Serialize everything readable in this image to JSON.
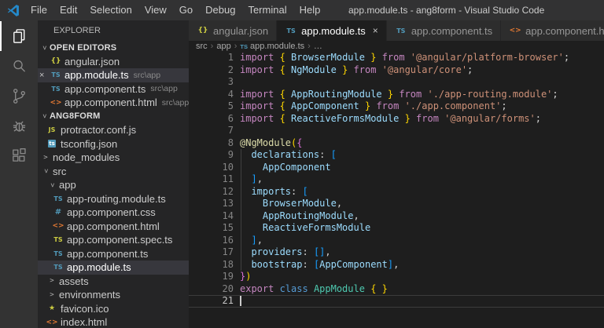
{
  "titlebar": {
    "logo_icon": "vscode-logo-icon",
    "menus": [
      "File",
      "Edit",
      "Selection",
      "View",
      "Go",
      "Debug",
      "Terminal",
      "Help"
    ],
    "title": "app.module.ts - ang8form - Visual Studio Code"
  },
  "activity_bar": [
    {
      "icon": "explorer-icon",
      "active": true
    },
    {
      "icon": "search-icon",
      "active": false
    },
    {
      "icon": "source-control-icon",
      "active": false
    },
    {
      "icon": "debug-icon",
      "active": false
    },
    {
      "icon": "extensions-icon",
      "active": false
    }
  ],
  "sidebar": {
    "title": "EXPLORER",
    "rows": [
      {
        "type": "section",
        "label": "OPEN EDITORS",
        "chevron": "down"
      },
      {
        "type": "editor",
        "label": "angular.json",
        "icon": "json-icon"
      },
      {
        "type": "editor",
        "label": "app.module.ts",
        "desc": "src\\app",
        "icon": "ts-icon",
        "close": true,
        "selected": true
      },
      {
        "type": "editor",
        "label": "app.component.ts",
        "desc": "src\\app",
        "icon": "ts-icon"
      },
      {
        "type": "editor",
        "label": "app.component.html",
        "desc": "src\\app",
        "icon": "html-icon"
      },
      {
        "type": "section",
        "label": "ANG8FORM",
        "chevron": "down"
      },
      {
        "type": "file",
        "label": "protractor.conf.js",
        "icon": "js-icon",
        "indent": 8
      },
      {
        "type": "file",
        "label": "tsconfig.json",
        "icon": "tsconfig-icon",
        "indent": 8
      },
      {
        "type": "folder",
        "label": "node_modules",
        "chevron": "right",
        "indent": 2
      },
      {
        "type": "folder",
        "label": "src",
        "chevron": "down",
        "indent": 2
      },
      {
        "type": "folder",
        "label": "app",
        "chevron": "down",
        "indent": 10
      },
      {
        "type": "file",
        "label": "app-routing.module.ts",
        "icon": "ts-icon",
        "indent": 16
      },
      {
        "type": "file",
        "label": "app.component.css",
        "icon": "css-icon",
        "indent": 16
      },
      {
        "type": "file",
        "label": "app.component.html",
        "icon": "html-icon",
        "indent": 16
      },
      {
        "type": "file",
        "label": "app.component.spec.ts",
        "icon": "ts-spec-icon",
        "indent": 16
      },
      {
        "type": "file",
        "label": "app.component.ts",
        "icon": "ts-icon",
        "indent": 16
      },
      {
        "type": "file",
        "label": "app.module.ts",
        "icon": "ts-icon",
        "indent": 16,
        "selected": true
      },
      {
        "type": "folder",
        "label": "assets",
        "chevron": "right",
        "indent": 10
      },
      {
        "type": "folder",
        "label": "environments",
        "chevron": "right",
        "indent": 10
      },
      {
        "type": "file",
        "label": "favicon.ico",
        "icon": "star-icon",
        "indent": 8
      },
      {
        "type": "file",
        "label": "index.html",
        "icon": "html-icon",
        "indent": 8
      }
    ]
  },
  "editor": {
    "tabs": [
      {
        "label": "angular.json",
        "icon": "json-icon",
        "active": false,
        "close": false
      },
      {
        "label": "app.module.ts",
        "icon": "ts-icon",
        "active": true,
        "close": true
      },
      {
        "label": "app.component.ts",
        "icon": "ts-icon",
        "active": false,
        "close": false
      },
      {
        "label": "app.component.html",
        "icon": "html-icon",
        "active": false,
        "close": false
      }
    ],
    "breadcrumb": [
      {
        "label": "src"
      },
      {
        "label": "app"
      },
      {
        "label": "app.module.ts",
        "icon": "ts-icon"
      },
      {
        "label": "…"
      }
    ],
    "code_lines": [
      {
        "n": 1,
        "tokens": [
          [
            "k",
            "import "
          ],
          [
            "b1",
            "{"
          ],
          [
            "d",
            " "
          ],
          [
            "v",
            "BrowserModule"
          ],
          [
            "d",
            " "
          ],
          [
            "b1",
            "}"
          ],
          [
            "k",
            " from "
          ],
          [
            "s",
            "'@angular/platform-browser'"
          ],
          [
            "d",
            ";"
          ]
        ]
      },
      {
        "n": 2,
        "tokens": [
          [
            "k",
            "import "
          ],
          [
            "b1",
            "{"
          ],
          [
            "d",
            " "
          ],
          [
            "v",
            "NgModule"
          ],
          [
            "d",
            " "
          ],
          [
            "b1",
            "}"
          ],
          [
            "k",
            " from "
          ],
          [
            "s",
            "'@angular/core'"
          ],
          [
            "d",
            ";"
          ]
        ]
      },
      {
        "n": 3,
        "tokens": []
      },
      {
        "n": 4,
        "tokens": [
          [
            "k",
            "import "
          ],
          [
            "b1",
            "{"
          ],
          [
            "d",
            " "
          ],
          [
            "v",
            "AppRoutingModule"
          ],
          [
            "d",
            " "
          ],
          [
            "b1",
            "}"
          ],
          [
            "k",
            " from "
          ],
          [
            "s",
            "'./app-routing.module'"
          ],
          [
            "d",
            ";"
          ]
        ]
      },
      {
        "n": 5,
        "tokens": [
          [
            "k",
            "import "
          ],
          [
            "b1",
            "{"
          ],
          [
            "d",
            " "
          ],
          [
            "v",
            "AppComponent"
          ],
          [
            "d",
            " "
          ],
          [
            "b1",
            "}"
          ],
          [
            "k",
            " from "
          ],
          [
            "s",
            "'./app.component'"
          ],
          [
            "d",
            ";"
          ]
        ]
      },
      {
        "n": 6,
        "tokens": [
          [
            "k",
            "import "
          ],
          [
            "b1",
            "{"
          ],
          [
            "d",
            " "
          ],
          [
            "v",
            "ReactiveFormsModule"
          ],
          [
            "d",
            " "
          ],
          [
            "b1",
            "}"
          ],
          [
            "k",
            " from "
          ],
          [
            "s",
            "'@angular/forms'"
          ],
          [
            "d",
            ";"
          ]
        ]
      },
      {
        "n": 7,
        "tokens": []
      },
      {
        "n": 8,
        "tokens": [
          [
            "f",
            "@NgModule"
          ],
          [
            "b1",
            "("
          ],
          [
            "b2",
            "{"
          ]
        ]
      },
      {
        "n": 9,
        "guide": true,
        "tokens": [
          [
            "d",
            "  "
          ],
          [
            "v",
            "declarations"
          ],
          [
            "d",
            ": "
          ],
          [
            "b3",
            "["
          ]
        ]
      },
      {
        "n": 10,
        "guide": true,
        "tokens": [
          [
            "d",
            "    "
          ],
          [
            "v",
            "AppComponent"
          ]
        ]
      },
      {
        "n": 11,
        "guide": true,
        "tokens": [
          [
            "d",
            "  "
          ],
          [
            "b3",
            "]"
          ],
          [
            "d",
            ","
          ]
        ]
      },
      {
        "n": 12,
        "guide": true,
        "tokens": [
          [
            "d",
            "  "
          ],
          [
            "v",
            "imports"
          ],
          [
            "d",
            ": "
          ],
          [
            "b3",
            "["
          ]
        ]
      },
      {
        "n": 13,
        "guide": true,
        "tokens": [
          [
            "d",
            "    "
          ],
          [
            "v",
            "BrowserModule"
          ],
          [
            "d",
            ","
          ]
        ]
      },
      {
        "n": 14,
        "guide": true,
        "tokens": [
          [
            "d",
            "    "
          ],
          [
            "v",
            "AppRoutingModule"
          ],
          [
            "d",
            ","
          ]
        ]
      },
      {
        "n": 15,
        "guide": true,
        "tokens": [
          [
            "d",
            "    "
          ],
          [
            "v",
            "ReactiveFormsModule"
          ]
        ]
      },
      {
        "n": 16,
        "guide": true,
        "tokens": [
          [
            "d",
            "  "
          ],
          [
            "b3",
            "]"
          ],
          [
            "d",
            ","
          ]
        ]
      },
      {
        "n": 17,
        "guide": true,
        "tokens": [
          [
            "d",
            "  "
          ],
          [
            "v",
            "providers"
          ],
          [
            "d",
            ": "
          ],
          [
            "b3",
            "[]"
          ],
          [
            "d",
            ","
          ]
        ]
      },
      {
        "n": 18,
        "guide": true,
        "tokens": [
          [
            "d",
            "  "
          ],
          [
            "v",
            "bootstrap"
          ],
          [
            "d",
            ": "
          ],
          [
            "b3",
            "["
          ],
          [
            "v",
            "AppComponent"
          ],
          [
            "b3",
            "]"
          ],
          [
            "d",
            ","
          ]
        ]
      },
      {
        "n": 19,
        "tokens": [
          [
            "b2",
            "}"
          ],
          [
            "b1",
            ")"
          ]
        ]
      },
      {
        "n": 20,
        "tokens": [
          [
            "k",
            "export "
          ],
          [
            "kb",
            "class "
          ],
          [
            "c",
            "AppModule"
          ],
          [
            "d",
            " "
          ],
          [
            "b1",
            "{ }"
          ]
        ]
      },
      {
        "n": 21,
        "tokens": [],
        "current": true,
        "cursor": true
      }
    ]
  },
  "colors": {
    "kw": "#C586C0",
    "kw2": "#569CD6",
    "varc": "#9CDCFE",
    "cls": "#4EC9B0",
    "func": "#DCDCAA",
    "str": "#CE9178",
    "fg": "#D4D4D4",
    "b1": "#FFD700",
    "b2": "#DA70D6",
    "b3": "#179FFF",
    "tsblue": "#519ABA",
    "yellow": "#CBCB41",
    "orange": "#E37933",
    "selbg": "#37373D",
    "logoblue": "#2489CA",
    "editorbg": "#1E1E1E",
    "sidebarbg": "#252526",
    "activitybg": "#333333",
    "titlebg": "#323233",
    "tabinactive": "#2D2D2D"
  }
}
